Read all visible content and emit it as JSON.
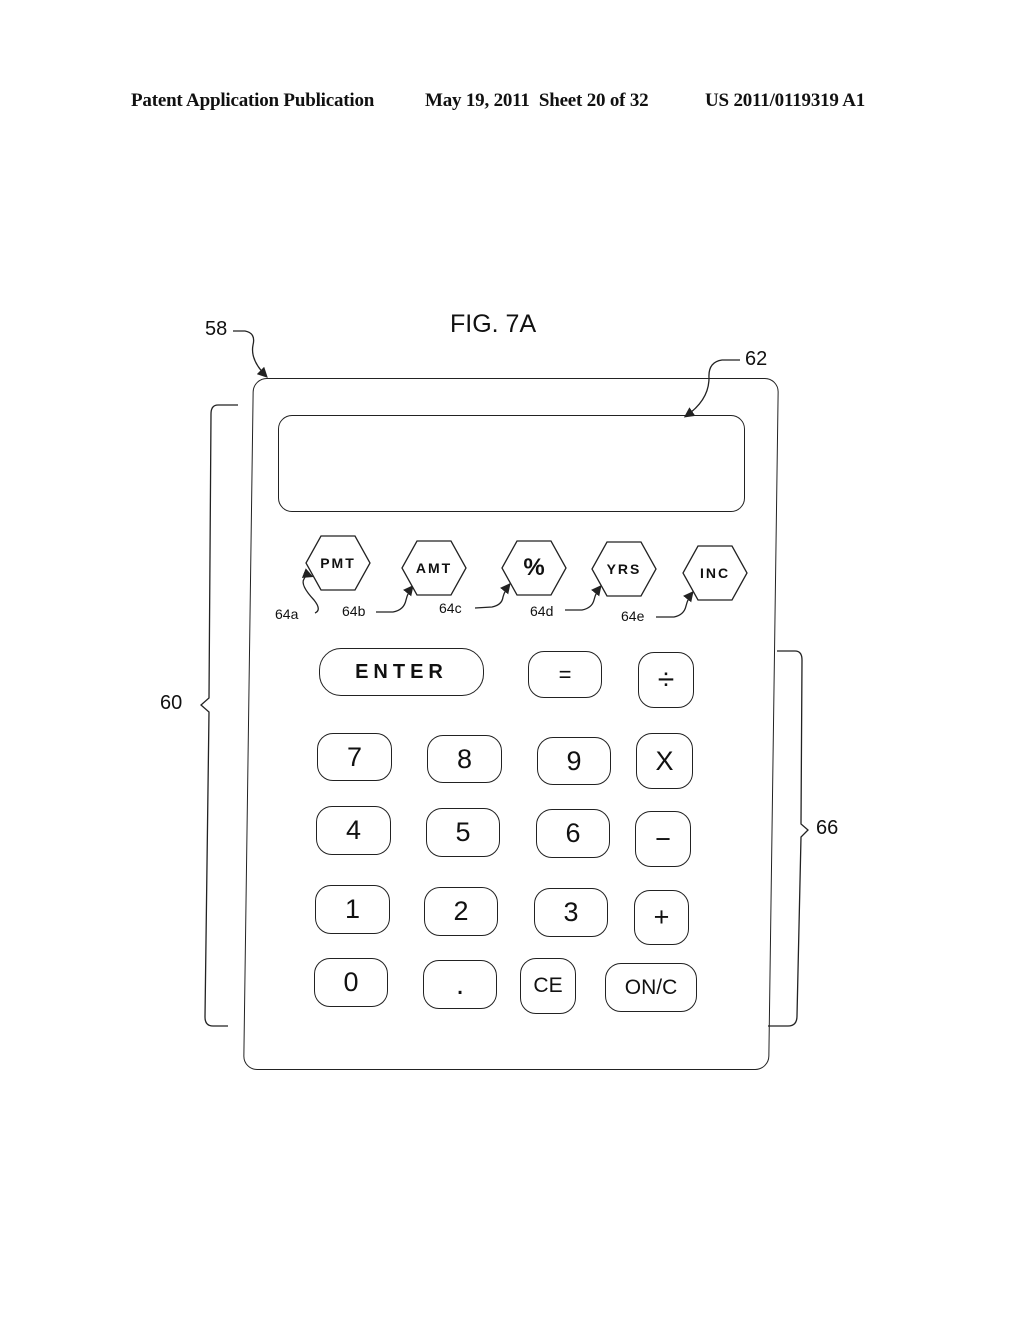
{
  "header": {
    "left": "Patent Application Publication",
    "middle": "May 19, 2011  Sheet 20 of 32",
    "right": "US 2011/0119319 A1"
  },
  "figure": {
    "title": "FIG. 7A",
    "refs": {
      "calculator": "58",
      "upper_region": "60",
      "display": "62",
      "keypad": "66"
    },
    "function_keys": [
      {
        "label": "PMT",
        "ref": "64a"
      },
      {
        "label": "AMT",
        "ref": "64b"
      },
      {
        "label": "%",
        "ref": "64c"
      },
      {
        "label": "YRS",
        "ref": "64d"
      },
      {
        "label": "INC",
        "ref": "64e"
      }
    ],
    "keys": {
      "enter": "ENTER",
      "equals": "=",
      "divide": "÷",
      "seven": "7",
      "eight": "8",
      "nine": "9",
      "multiply": "X",
      "four": "4",
      "five": "5",
      "six": "6",
      "minus": "−",
      "one": "1",
      "two": "2",
      "three": "3",
      "plus": "+",
      "zero": "0",
      "decimal": ".",
      "clear_entry": "CE",
      "on_clear": "ON/C"
    }
  }
}
